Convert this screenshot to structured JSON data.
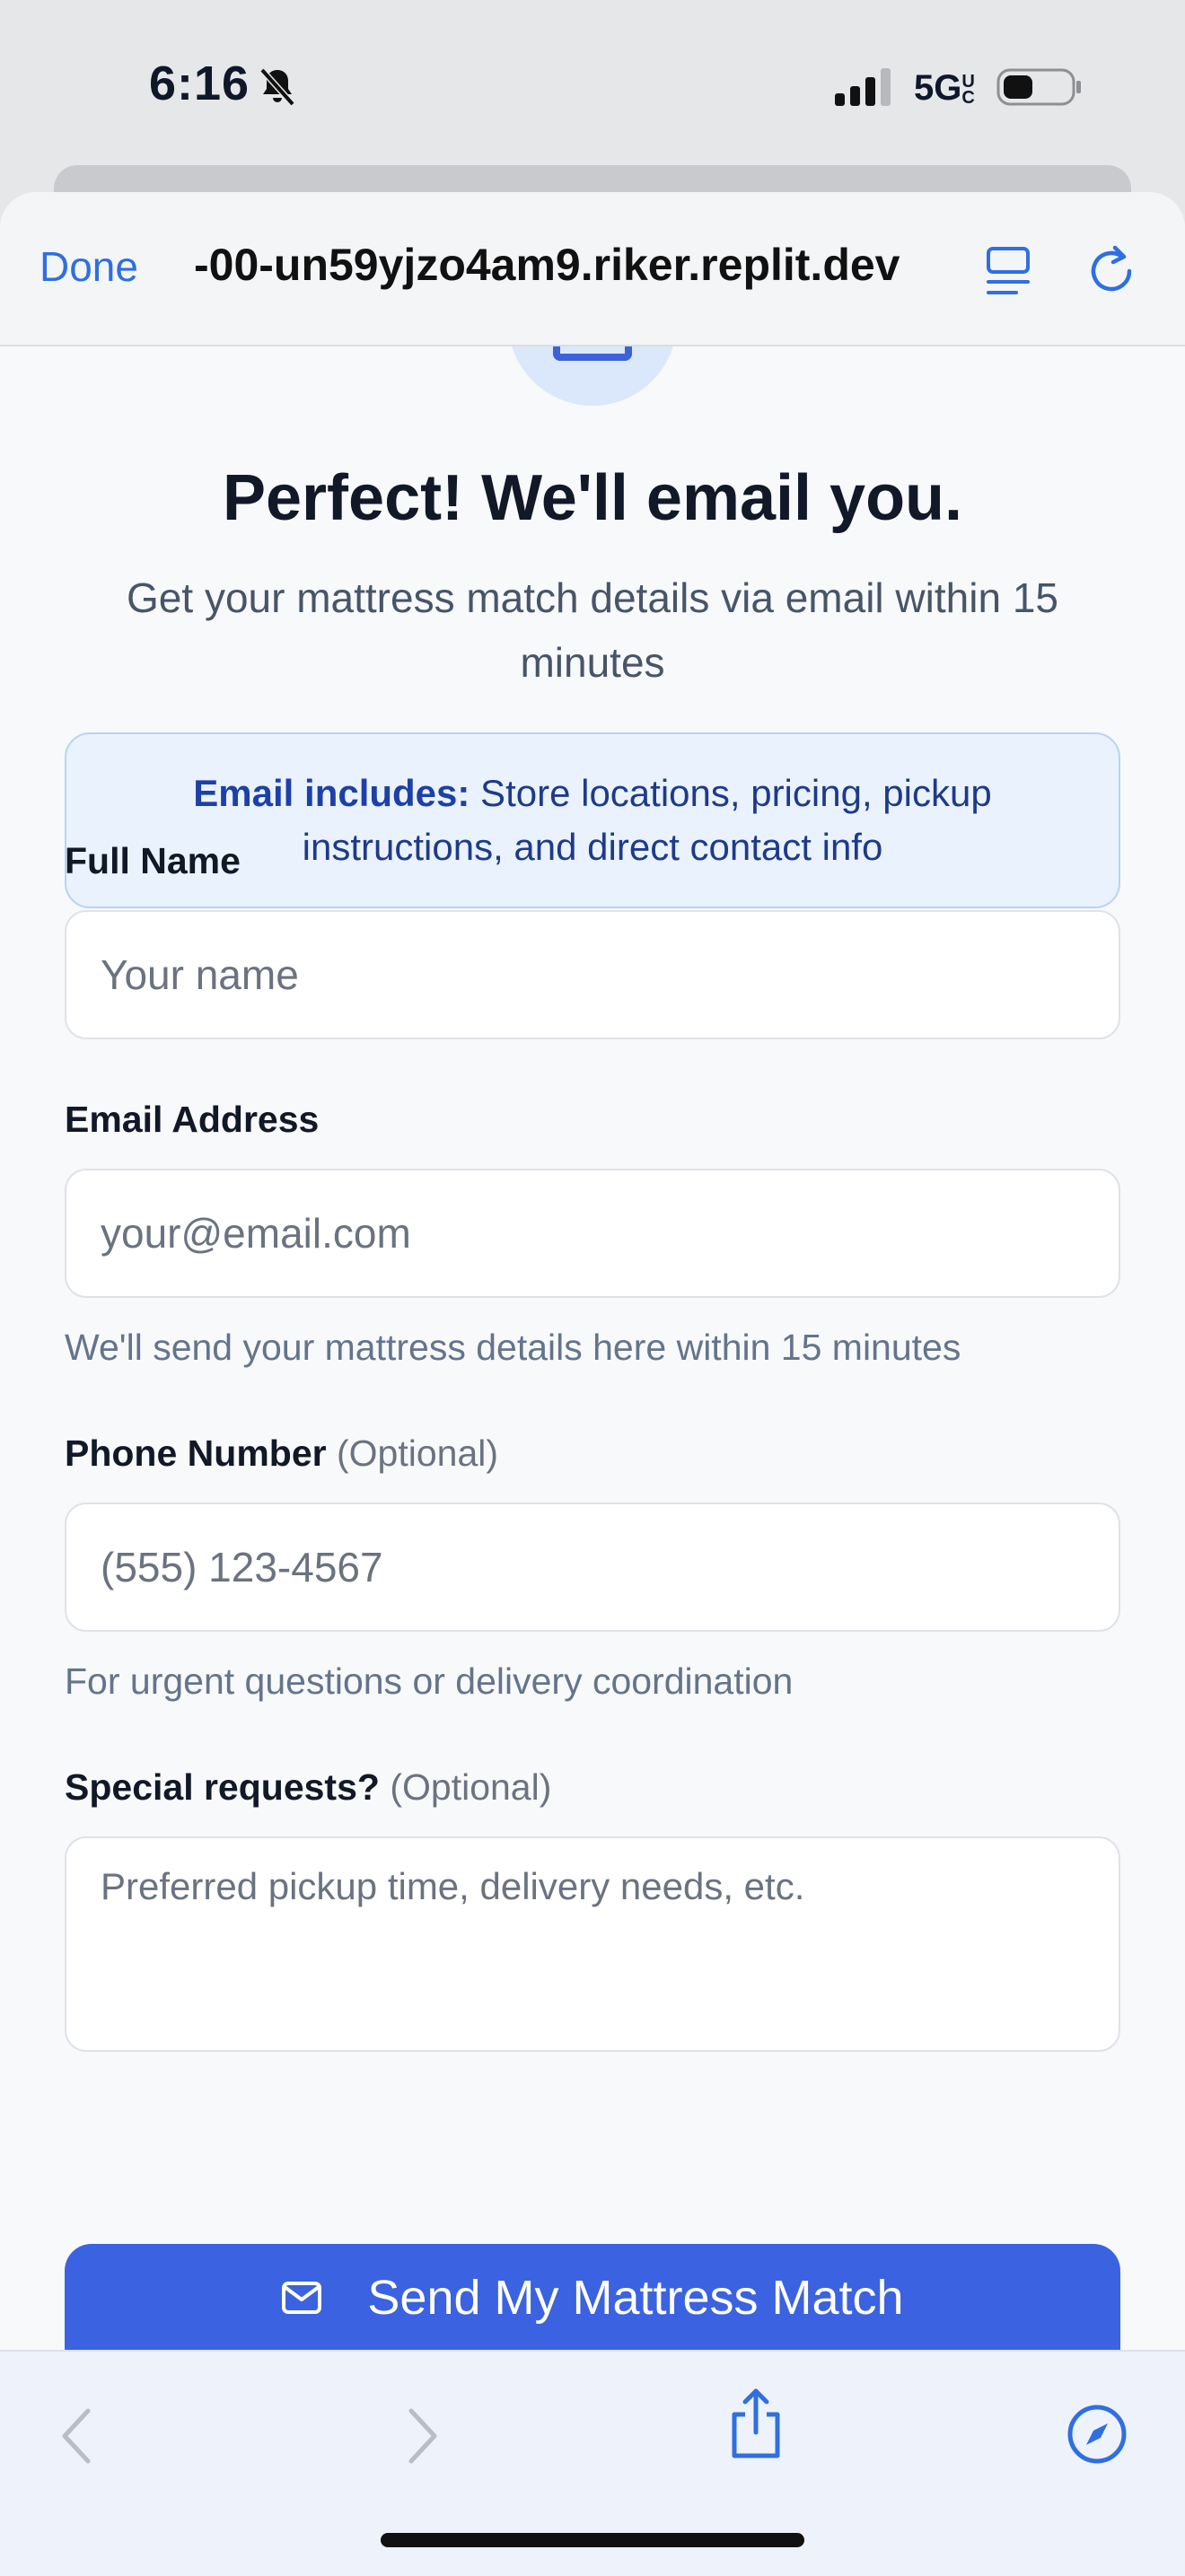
{
  "status_bar": {
    "time": "6:16",
    "network": "5G",
    "network_suffix": "UC"
  },
  "browser": {
    "done_label": "Done",
    "url": "-00-un59yjzo4am9.riker.replit.dev"
  },
  "page": {
    "title": "Perfect! We'll email you.",
    "subtitle": "Get your mattress match details via email within 15 minutes",
    "info": {
      "bold": "Email includes:",
      "text": " Store locations, pricing, pickup instructions, and direct contact info"
    },
    "fields": {
      "full_name": {
        "label": "Full Name",
        "placeholder": "Your name"
      },
      "email": {
        "label": "Email Address",
        "placeholder": "your@email.com",
        "hint": "We'll send your mattress details here within 15 minutes"
      },
      "phone": {
        "label": "Phone Number",
        "optional": "(Optional)",
        "placeholder": "(555) 123-4567",
        "hint": "For urgent questions or delivery coordination"
      },
      "requests": {
        "label": "Special requests?",
        "optional": "(Optional)",
        "placeholder": "Preferred pickup time, delivery needs, etc."
      }
    },
    "submit_label": "Send My Mattress Match"
  },
  "colors": {
    "primary": "#3b62e0",
    "link": "#2f6fe0",
    "info_bg": "#eaf2fe",
    "info_text": "#1e3a8a"
  },
  "icons": [
    "bell-slash-icon",
    "signal-icon",
    "battery-icon",
    "reader-icon",
    "reload-icon",
    "mail-icon",
    "back-icon",
    "forward-icon",
    "share-icon",
    "compass-icon"
  ]
}
